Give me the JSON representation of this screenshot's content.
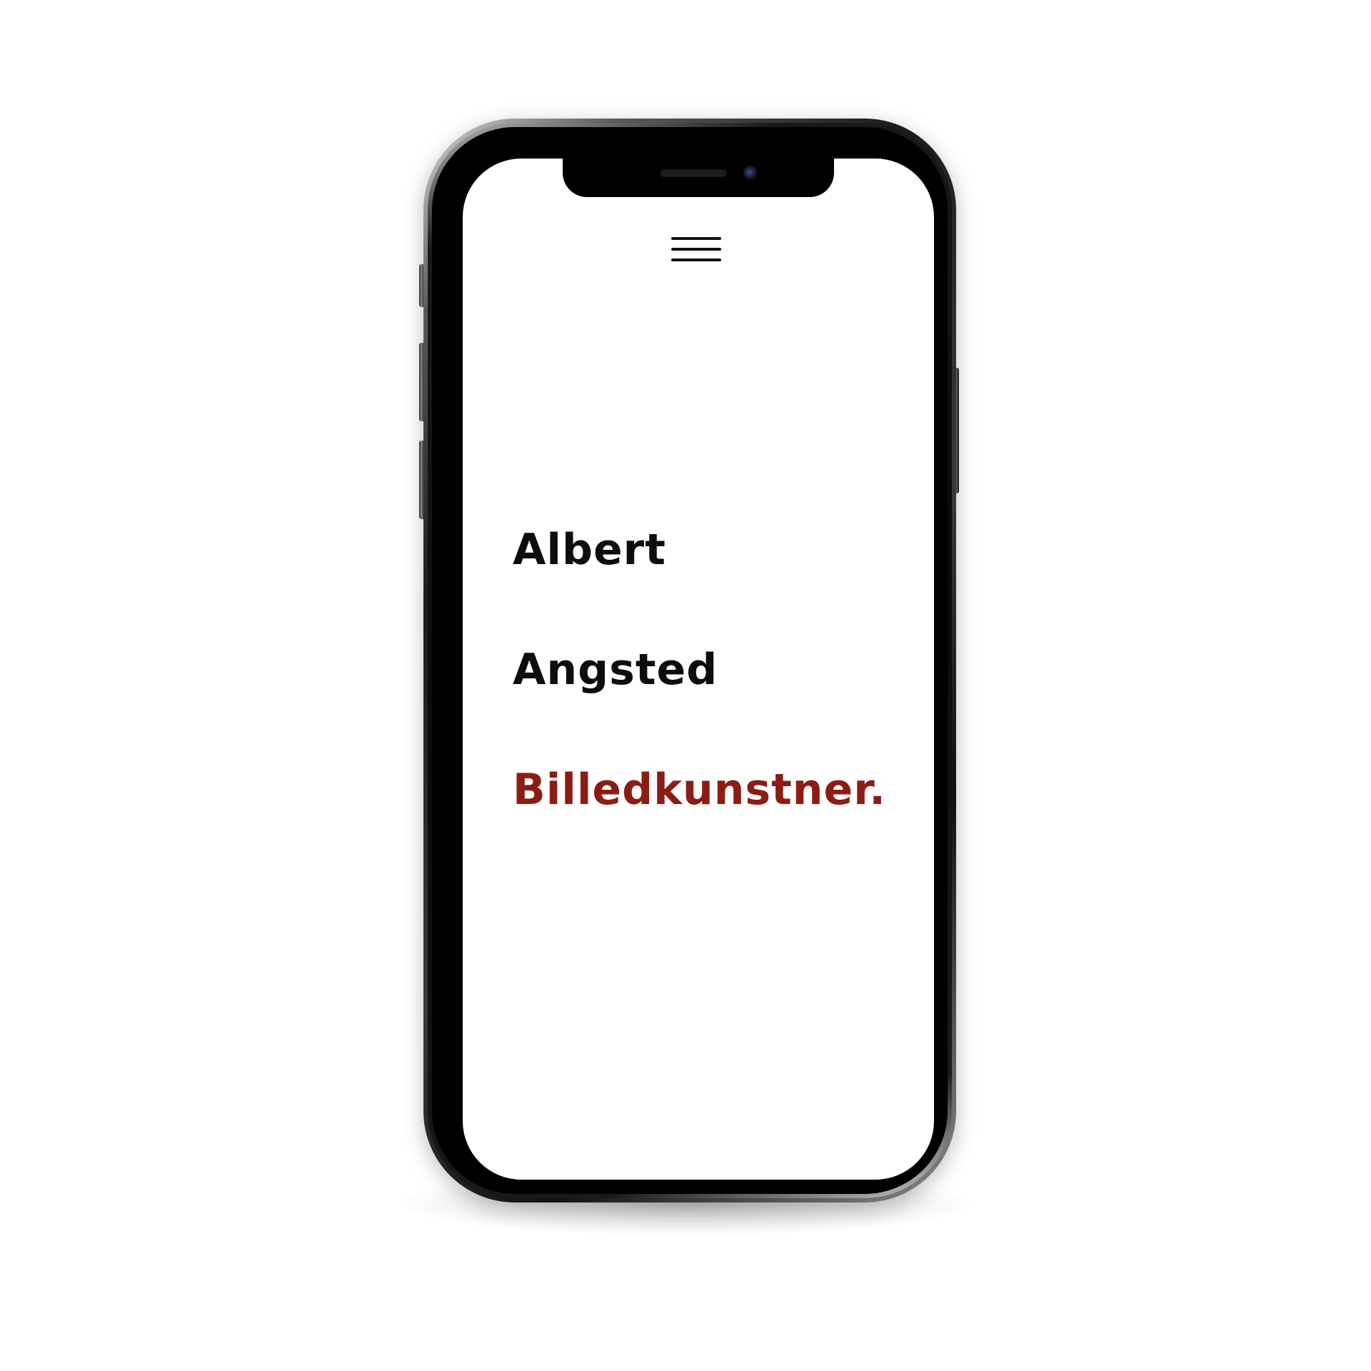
{
  "menu": {
    "icon": "hamburger-menu-icon"
  },
  "hero": {
    "first_name": "Albert",
    "last_name": "Angsted",
    "role": "Billedkunstner."
  },
  "colors": {
    "text": "#0d0d0d",
    "accent": "#8b1d14",
    "background": "#ffffff"
  }
}
